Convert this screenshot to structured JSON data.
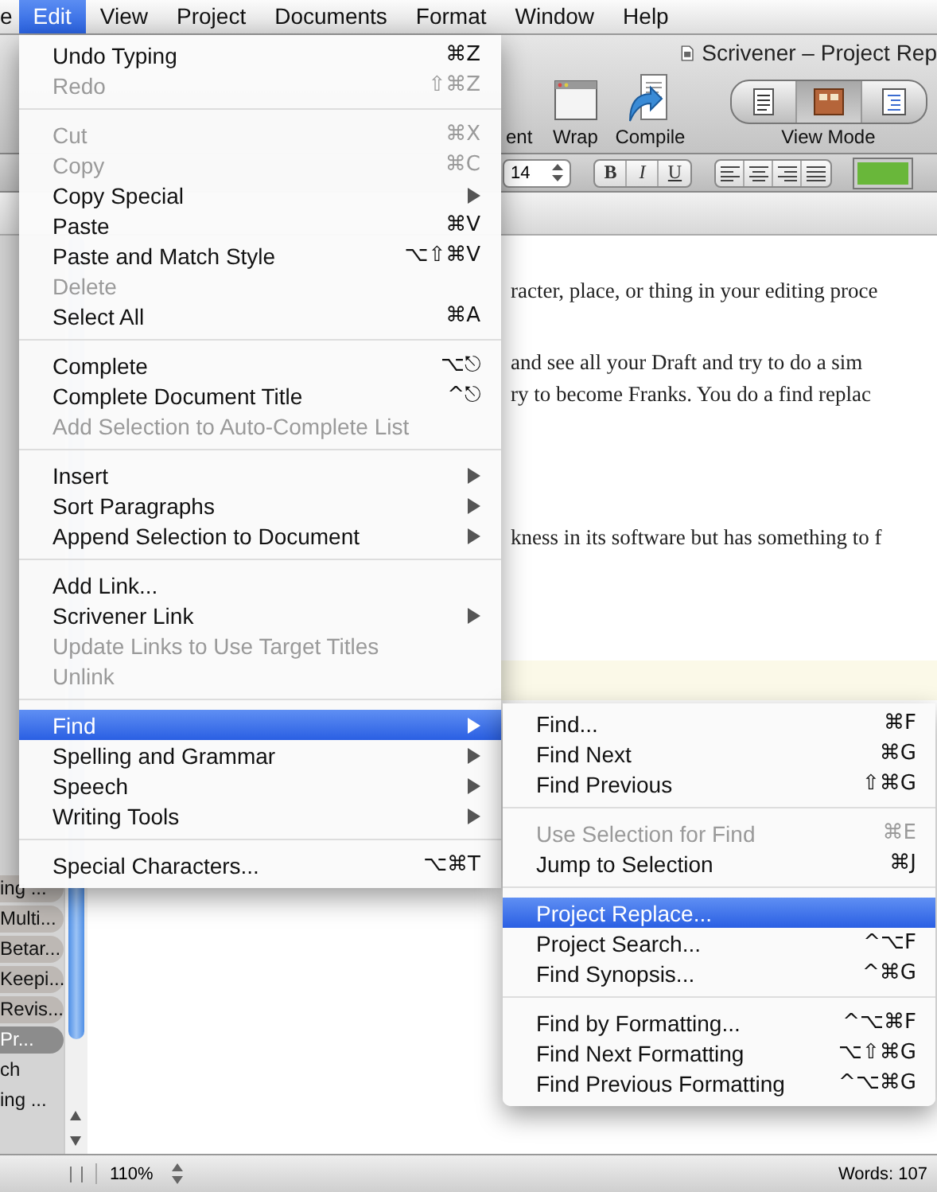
{
  "menubar": {
    "items": [
      {
        "label": "e",
        "selected": false
      },
      {
        "label": "Edit",
        "selected": true
      },
      {
        "label": "View",
        "selected": false
      },
      {
        "label": "Project",
        "selected": false
      },
      {
        "label": "Documents",
        "selected": false
      },
      {
        "label": "Format",
        "selected": false
      },
      {
        "label": "Window",
        "selected": false
      },
      {
        "label": "Help",
        "selected": false
      }
    ]
  },
  "window": {
    "title": "Scrivener – Project Rep"
  },
  "toolbar": {
    "items": [
      {
        "kind": "label",
        "label": "ent"
      },
      {
        "kind": "wrap",
        "label": "Wrap"
      },
      {
        "kind": "compile",
        "label": "Compile"
      },
      {
        "kind": "view_mode",
        "label": "View Mode",
        "segments": [
          {
            "selected": false
          },
          {
            "selected": true
          },
          {
            "selected": false
          }
        ]
      }
    ]
  },
  "format_bar": {
    "font_size": "14",
    "styles": [
      "B",
      "I",
      "U"
    ]
  },
  "binder": {
    "items": [
      {
        "label": "ing ...",
        "selected": false
      },
      {
        "label": "Multi...",
        "selected": false
      },
      {
        "label": "Betar...",
        "selected": false
      },
      {
        "label": "Keepi...",
        "selected": false
      },
      {
        "label": "Revis...",
        "selected": false
      },
      {
        "label": "Pr...",
        "selected": true
      },
      {
        "label": "ch",
        "selected": false
      },
      {
        "label": "ing ...",
        "selected": false
      }
    ]
  },
  "editor": {
    "lines": [
      "racter, place, or thing in your editing proce",
      "and see all your Draft and try to do a sim",
      "ry to become Franks. You do a find replac",
      "kness in its software but has something to f"
    ]
  },
  "edit_menu": {
    "entries": [
      {
        "kind": "item",
        "label": "Undo Typing",
        "shortcut": "⌘Z",
        "disabled": false,
        "submenu": false,
        "selected": false
      },
      {
        "kind": "item",
        "label": "Redo",
        "shortcut": "⇧⌘Z",
        "disabled": true,
        "submenu": false,
        "selected": false
      },
      {
        "kind": "separator"
      },
      {
        "kind": "item",
        "label": "Cut",
        "shortcut": "⌘X",
        "disabled": true,
        "submenu": false,
        "selected": false
      },
      {
        "kind": "item",
        "label": "Copy",
        "shortcut": "⌘C",
        "disabled": true,
        "submenu": false,
        "selected": false
      },
      {
        "kind": "item",
        "label": "Copy Special",
        "disabled": false,
        "submenu": true,
        "selected": false
      },
      {
        "kind": "item",
        "label": "Paste",
        "shortcut": "⌘V",
        "disabled": false,
        "submenu": false,
        "selected": false
      },
      {
        "kind": "item",
        "label": "Paste and Match Style",
        "shortcut": "⌥⇧⌘V",
        "disabled": false,
        "submenu": false,
        "selected": false
      },
      {
        "kind": "item",
        "label": "Delete",
        "disabled": true,
        "submenu": false,
        "selected": false
      },
      {
        "kind": "item",
        "label": "Select All",
        "shortcut": "⌘A",
        "disabled": false,
        "submenu": false,
        "selected": false
      },
      {
        "kind": "separator"
      },
      {
        "kind": "item",
        "label": "Complete",
        "shortcut": "⌥⎋",
        "disabled": false,
        "submenu": false,
        "selected": false
      },
      {
        "kind": "item",
        "label": "Complete Document Title",
        "shortcut": "^⎋",
        "disabled": false,
        "submenu": false,
        "selected": false
      },
      {
        "kind": "item",
        "label": "Add Selection to Auto-Complete List",
        "disabled": true,
        "submenu": false,
        "selected": false
      },
      {
        "kind": "separator"
      },
      {
        "kind": "item",
        "label": "Insert",
        "disabled": false,
        "submenu": true,
        "selected": false
      },
      {
        "kind": "item",
        "label": "Sort Paragraphs",
        "disabled": false,
        "submenu": true,
        "selected": false
      },
      {
        "kind": "item",
        "label": "Append Selection to Document",
        "disabled": false,
        "submenu": true,
        "selected": false
      },
      {
        "kind": "separator"
      },
      {
        "kind": "item",
        "label": "Add Link...",
        "disabled": false,
        "submenu": false,
        "selected": false
      },
      {
        "kind": "item",
        "label": "Scrivener Link",
        "disabled": false,
        "submenu": true,
        "selected": false
      },
      {
        "kind": "item",
        "label": "Update Links to Use Target Titles",
        "disabled": true,
        "submenu": false,
        "selected": false
      },
      {
        "kind": "item",
        "label": "Unlink",
        "disabled": true,
        "submenu": false,
        "selected": false
      },
      {
        "kind": "separator"
      },
      {
        "kind": "item",
        "label": "Find",
        "disabled": false,
        "submenu": true,
        "selected": true
      },
      {
        "kind": "item",
        "label": "Spelling and Grammar",
        "disabled": false,
        "submenu": true,
        "selected": false
      },
      {
        "kind": "item",
        "label": "Speech",
        "disabled": false,
        "submenu": true,
        "selected": false
      },
      {
        "kind": "item",
        "label": "Writing Tools",
        "disabled": false,
        "submenu": true,
        "selected": false
      },
      {
        "kind": "separator"
      },
      {
        "kind": "item",
        "label": "Special Characters...",
        "shortcut": "⌥⌘T",
        "disabled": false,
        "submenu": false,
        "selected": false
      }
    ]
  },
  "find_submenu": {
    "entries": [
      {
        "kind": "item",
        "label": "Find...",
        "shortcut": "⌘F",
        "disabled": false,
        "selected": false
      },
      {
        "kind": "item",
        "label": "Find Next",
        "shortcut": "⌘G",
        "disabled": false,
        "selected": false
      },
      {
        "kind": "item",
        "label": "Find Previous",
        "shortcut": "⇧⌘G",
        "disabled": false,
        "selected": false
      },
      {
        "kind": "separator"
      },
      {
        "kind": "item",
        "label": "Use Selection for Find",
        "shortcut": "⌘E",
        "disabled": true,
        "selected": false
      },
      {
        "kind": "item",
        "label": "Jump to Selection",
        "shortcut": "⌘J",
        "disabled": false,
        "selected": false
      },
      {
        "kind": "separator"
      },
      {
        "kind": "item",
        "label": "Project Replace...",
        "disabled": false,
        "selected": true
      },
      {
        "kind": "item",
        "label": "Project Search...",
        "shortcut": "^⌥F",
        "disabled": false,
        "selected": false
      },
      {
        "kind": "item",
        "label": "Find Synopsis...",
        "shortcut": "^⌘G",
        "disabled": false,
        "selected": false
      },
      {
        "kind": "separator"
      },
      {
        "kind": "item",
        "label": "Find by Formatting...",
        "shortcut": "^⌥⌘F",
        "disabled": false,
        "selected": false
      },
      {
        "kind": "item",
        "label": "Find Next Formatting",
        "shortcut": "⌥⇧⌘G",
        "disabled": false,
        "selected": false
      },
      {
        "kind": "item",
        "label": "Find Previous Formatting",
        "shortcut": "^⌥⌘G",
        "disabled": false,
        "selected": false
      }
    ]
  },
  "status_bar": {
    "zoom": "110%",
    "words": "Words: 107"
  }
}
